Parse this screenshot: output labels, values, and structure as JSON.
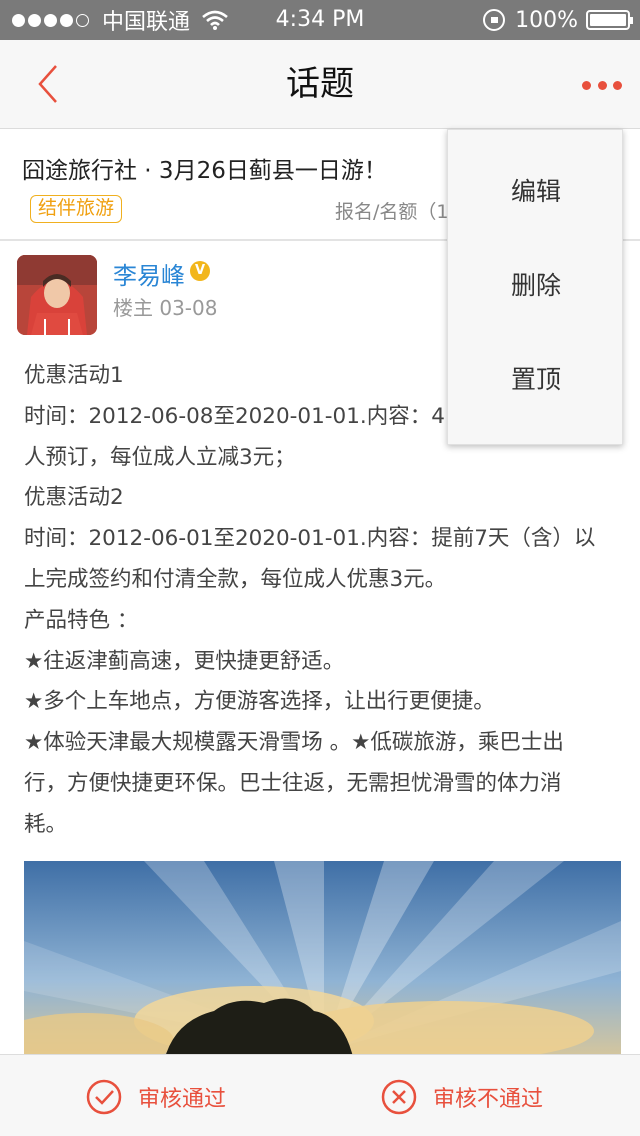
{
  "status_bar": {
    "carrier": "中国联通",
    "time": "4:34 PM",
    "battery": "100%",
    "signal_bars": 4,
    "battery_level": 1.0
  },
  "nav": {
    "title": "话题",
    "back_icon": "chevron-left-icon",
    "more_icon": "more-dots-icon",
    "accent": "#e8503d"
  },
  "topic": {
    "title": "囧途旅行社 · 3月26日蓟县一日游！",
    "tag": "结伴旅游",
    "meta": "报名/名额（1"
  },
  "author": {
    "name": "李易峰",
    "verified_badge": "V",
    "role_date": "楼主 03-08"
  },
  "content": {
    "lines": [
      "优惠活动1",
      "时间：2012-06-08至2020-01-01.内容：4",
      "人预订，每位成人立减3元；",
      "优惠活动2",
      "时间：2012-06-01至2020-01-01.内容：提前7天（含）以",
      "上完成签约和付清全款，每位成人优惠3元。",
      "产品特色 ：",
      "★往返津蓟高速，更快捷更舒适。",
      "★多个上车地点，方便游客选择，让出行更便捷。",
      "★体验天津最大规模露天滑雪场 。★低碳旅游，乘巴士出",
      "行，方便快捷更环保。巴士往返，无需担忧滑雪的体力消",
      "耗。"
    ]
  },
  "dropdown": {
    "items": [
      "编辑",
      "删除",
      "置顶"
    ]
  },
  "bottom_bar": {
    "approve_label": "审核通过",
    "reject_label": "审核不通过",
    "approve_icon": "check-circle-icon",
    "reject_icon": "x-circle-icon"
  }
}
